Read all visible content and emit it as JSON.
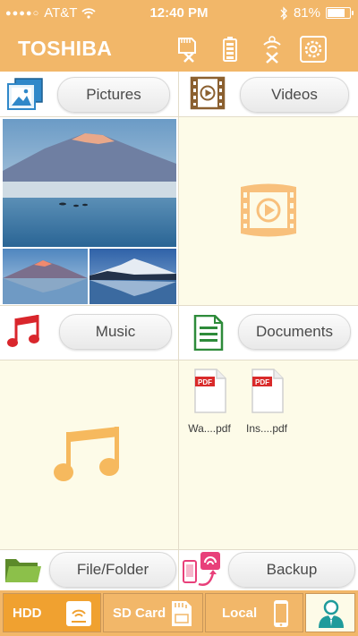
{
  "status_bar": {
    "carrier": "AT&T",
    "time": "12:40 PM",
    "battery": "81%"
  },
  "header": {
    "brand": "TOSHIBA"
  },
  "sections": {
    "pictures": {
      "label": "Pictures"
    },
    "videos": {
      "label": "Videos"
    },
    "music": {
      "label": "Music"
    },
    "documents": {
      "label": "Documents"
    },
    "file_folder": {
      "label": "File/Folder"
    },
    "backup": {
      "label": "Backup"
    }
  },
  "documents": {
    "files": [
      {
        "name": "Wa....pdf",
        "badge": "PDF"
      },
      {
        "name": "Ins....pdf",
        "badge": "PDF"
      }
    ]
  },
  "tabs": [
    {
      "label": "HDD",
      "active": true,
      "icon": "hdd-icon"
    },
    {
      "label": "SD Card",
      "active": false,
      "icon": "sd-card-icon"
    },
    {
      "label": "Local",
      "active": false,
      "icon": "phone-icon"
    }
  ],
  "colors": {
    "brand": "#f2b769",
    "panel": "#fdfbe8",
    "tab_active": "#f0a130",
    "music_red": "#d9262c",
    "document_green": "#2e8b3a"
  }
}
